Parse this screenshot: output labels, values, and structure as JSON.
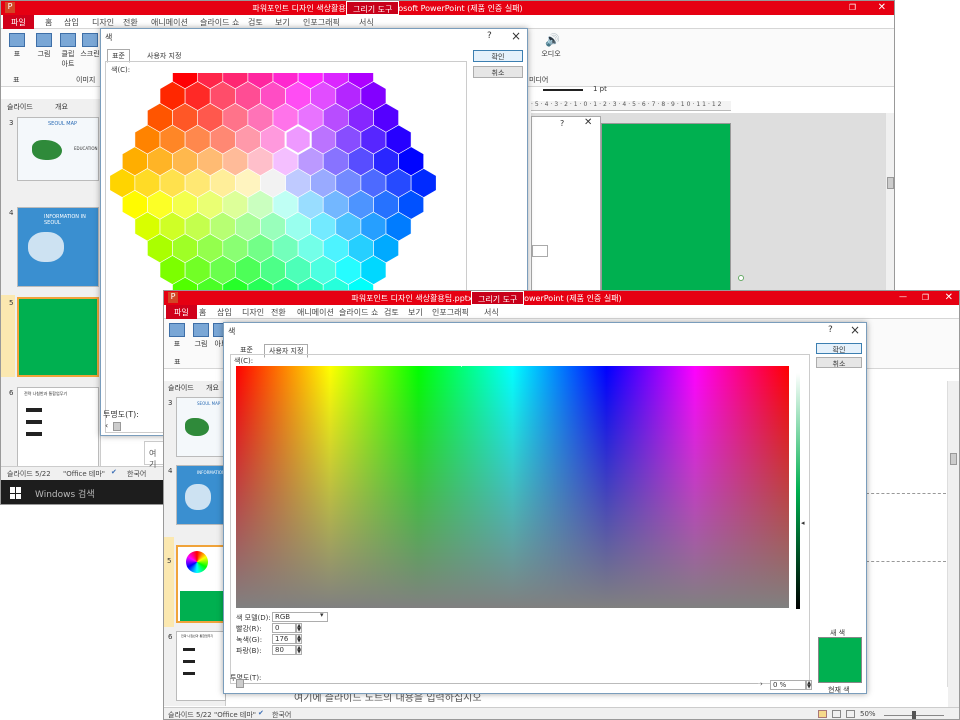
{
  "back": {
    "title": "파워포인트 디자인 색상활용팁.pptx - Microsoft PowerPoint (제품 인증 실패)",
    "context_tab": "그리기 도구",
    "tabs": [
      "파일",
      "홈",
      "삽입",
      "디자인",
      "전환",
      "애니메이션",
      "슬라이드 쇼",
      "검토",
      "보기",
      "인포그래픽",
      "서식"
    ],
    "ribbon": {
      "btn1": "표",
      "btn2": "그림",
      "btn3": "클립\n아트",
      "btn4": "스크린",
      "group_image": "이미지",
      "group_table": "표",
      "audio": "오디오",
      "group_media": "미디어"
    },
    "line_weight": "1 pt",
    "left_tabs": [
      "슬라이드",
      "개요"
    ],
    "slide_nums": [
      "3",
      "4",
      "5",
      "6"
    ],
    "thumb3_title": "SEOUL MAP",
    "thumb3_sub": "EDUCATION",
    "thumb4_title": "INFORMATION IN SEOUL",
    "thumb6_title": "전략 나침반과 통합업무기",
    "notes_hint": "여기",
    "status": {
      "slide": "슬라이드 5/22",
      "theme": "\"Office 테마\"",
      "lang": "한국어"
    },
    "taskbar_search": "Windows 검색"
  },
  "dialog1": {
    "title": "색",
    "tab_standard": "표준",
    "tab_custom": "사용자 지정",
    "color_label": "색(C):",
    "ok": "확인",
    "cancel": "취소",
    "transparency": "투명도(T):"
  },
  "front": {
    "title": "파워포인트 디자인 색상활용팁.pptx - Microsoft PowerPoint (제품 인증 실패)",
    "context_tab": "그리기 도구",
    "tabs": [
      "파일",
      "홈",
      "삽입",
      "디자인",
      "전환",
      "애니메이션",
      "슬라이드 쇼",
      "검토",
      "보기",
      "인포그래픽",
      "서식"
    ],
    "ribbon": {
      "btn1": "표",
      "btn2": "그림",
      "btn3": "아트",
      "group": "표"
    },
    "left_tabs": [
      "슬라이드",
      "개요"
    ],
    "slide_nums": [
      "3",
      "4",
      "5",
      "6"
    ],
    "thumb3_title": "SEOUL MAP",
    "thumb4_title": "INFORMATION",
    "thumb6_title": "전략 나침반과 통합업무기",
    "notes": "여기에 슬라이드 노트의 내용을 입력하십시오",
    "status": {
      "slide": "슬라이드 5/22",
      "theme": "\"Office 테마\"",
      "lang": "한국어",
      "zoom": "50%"
    }
  },
  "dialog2": {
    "title": "색",
    "tab_standard": "표준",
    "tab_custom": "사용자 지정",
    "color_label": "색(C):",
    "model_label": "색 모델(D):",
    "model_value": "RGB",
    "red_label": "빨강(R):",
    "red": "0",
    "green_label": "녹색(G):",
    "green": "176",
    "blue_label": "파랑(B):",
    "blue": "80",
    "transparency_label": "투명도(T):",
    "transparency": "0 %",
    "ok": "확인",
    "cancel": "취소",
    "new_label": "새 색",
    "current_label": "현재 색"
  },
  "colors": {
    "selected": "#00b050",
    "ribbon_red": "#e60012"
  }
}
